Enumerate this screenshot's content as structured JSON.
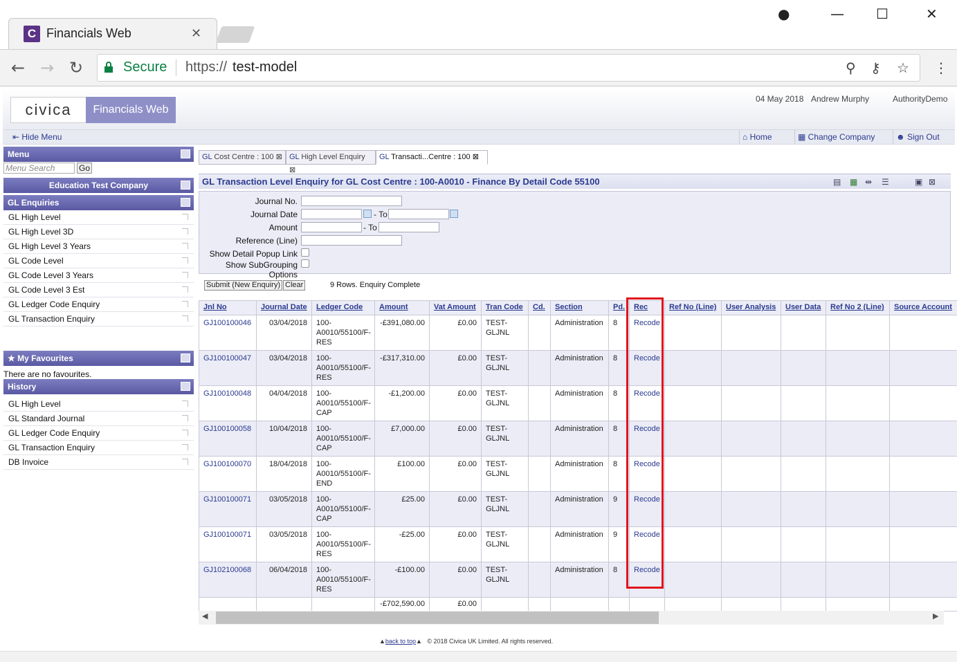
{
  "browser": {
    "tab_title": "Financials Web",
    "tab_logo": "C",
    "secure_label": "Secure",
    "url_scheme": "https://",
    "url_host": "test-model"
  },
  "app": {
    "logo_text": "civica",
    "product": "Financials Web",
    "date": "04 May 2018",
    "user": "Andrew Murphy",
    "authority": "AuthorityDemo",
    "hide_menu": "Hide Menu",
    "home": "Home",
    "change_company": "Change Company",
    "sign_out": "Sign Out"
  },
  "sidebar": {
    "menu_title": "Menu",
    "search_placeholder": "Menu Search",
    "go": "Go",
    "company": "Education Test Company",
    "gl_title": "GL Enquiries",
    "gl_items": [
      "GL High Level",
      "GL High Level 3D",
      "GL High Level 3 Years",
      "GL Code Level",
      "GL Code Level 3 Years",
      "GL Code Level 3 Est",
      "GL Ledger Code Enquiry",
      "GL Transaction Enquiry"
    ],
    "fav_title": "My Favourites",
    "fav_empty": "There are no favourites.",
    "history_title": "History",
    "history_items": [
      "GL High Level",
      "GL Standard Journal",
      "GL Ledger Code Enquiry",
      "GL Transaction Enquiry",
      "DB Invoice"
    ]
  },
  "tabs": [
    {
      "prefix": "GL",
      "label": "Cost Centre : 100"
    },
    {
      "prefix": "GL",
      "label": "High Level Enquiry"
    },
    {
      "prefix": "GL",
      "label": "Transacti...Centre : 100"
    }
  ],
  "panel": {
    "title": "GL Transaction Level Enquiry for GL Cost Centre : 100-A0010 - Finance By Detail Code 55100",
    "fields": {
      "journal_no": "Journal No.",
      "journal_date": "Journal Date",
      "amount": "Amount",
      "reference": "Reference (Line)",
      "detail_popup": "Show Detail Popup Link",
      "subgrouping": "Show SubGrouping Options",
      "to": "- To"
    },
    "submit": "Submit (New Enquiry)",
    "clear": "Clear",
    "status": "9 Rows. Enquiry Complete"
  },
  "grid": {
    "columns": [
      "Jnl No",
      "Journal Date",
      "Ledger Code",
      "Amount",
      "Vat Amount",
      "Tran Code",
      "Cd.",
      "Section",
      "Pd.",
      "Rec",
      "Ref No (Line)",
      "User Analysis",
      "User Data",
      "Ref No 2 (Line)",
      "Source Account"
    ],
    "rows": [
      {
        "jnl": "GJ100100046",
        "date": "03/04/2018",
        "ledger": "100-A0010/55100/F-RES",
        "amount": "-£391,080.00",
        "vat": "£0.00",
        "tran": "TEST-GLJNL",
        "section": "Administration",
        "pd": "8",
        "rec": "Recode"
      },
      {
        "jnl": "GJ100100047",
        "date": "03/04/2018",
        "ledger": "100-A0010/55100/F-RES",
        "amount": "-£317,310.00",
        "vat": "£0.00",
        "tran": "TEST-GLJNL",
        "section": "Administration",
        "pd": "8",
        "rec": "Recode"
      },
      {
        "jnl": "GJ100100048",
        "date": "04/04/2018",
        "ledger": "100-A0010/55100/F-CAP",
        "amount": "-£1,200.00",
        "vat": "£0.00",
        "tran": "TEST-GLJNL",
        "section": "Administration",
        "pd": "8",
        "rec": "Recode"
      },
      {
        "jnl": "GJ100100058",
        "date": "10/04/2018",
        "ledger": "100-A0010/55100/F-CAP",
        "amount": "£7,000.00",
        "vat": "£0.00",
        "tran": "TEST-GLJNL",
        "section": "Administration",
        "pd": "8",
        "rec": "Recode"
      },
      {
        "jnl": "GJ100100070",
        "date": "18/04/2018",
        "ledger": "100-A0010/55100/F-END",
        "amount": "£100.00",
        "vat": "£0.00",
        "tran": "TEST-GLJNL",
        "section": "Administration",
        "pd": "8",
        "rec": "Recode"
      },
      {
        "jnl": "GJ100100071",
        "date": "03/05/2018",
        "ledger": "100-A0010/55100/F-CAP",
        "amount": "£25.00",
        "vat": "£0.00",
        "tran": "TEST-GLJNL",
        "section": "Administration",
        "pd": "9",
        "rec": "Recode"
      },
      {
        "jnl": "GJ100100071",
        "date": "03/05/2018",
        "ledger": "100-A0010/55100/F-RES",
        "amount": "-£25.00",
        "vat": "£0.00",
        "tran": "TEST-GLJNL",
        "section": "Administration",
        "pd": "9",
        "rec": "Recode"
      },
      {
        "jnl": "GJ102100068",
        "date": "06/04/2018",
        "ledger": "100-A0010/55100/F-RES",
        "amount": "-£100.00",
        "vat": "£0.00",
        "tran": "TEST-GLJNL",
        "section": "Administration",
        "pd": "8",
        "rec": "Recode"
      }
    ],
    "total_amount": "-£702,590.00",
    "total_vat": "£0.00"
  },
  "footer": {
    "back_to_top": "back to top",
    "copyright": "© 2018 Civica UK Limited. All rights reserved."
  }
}
